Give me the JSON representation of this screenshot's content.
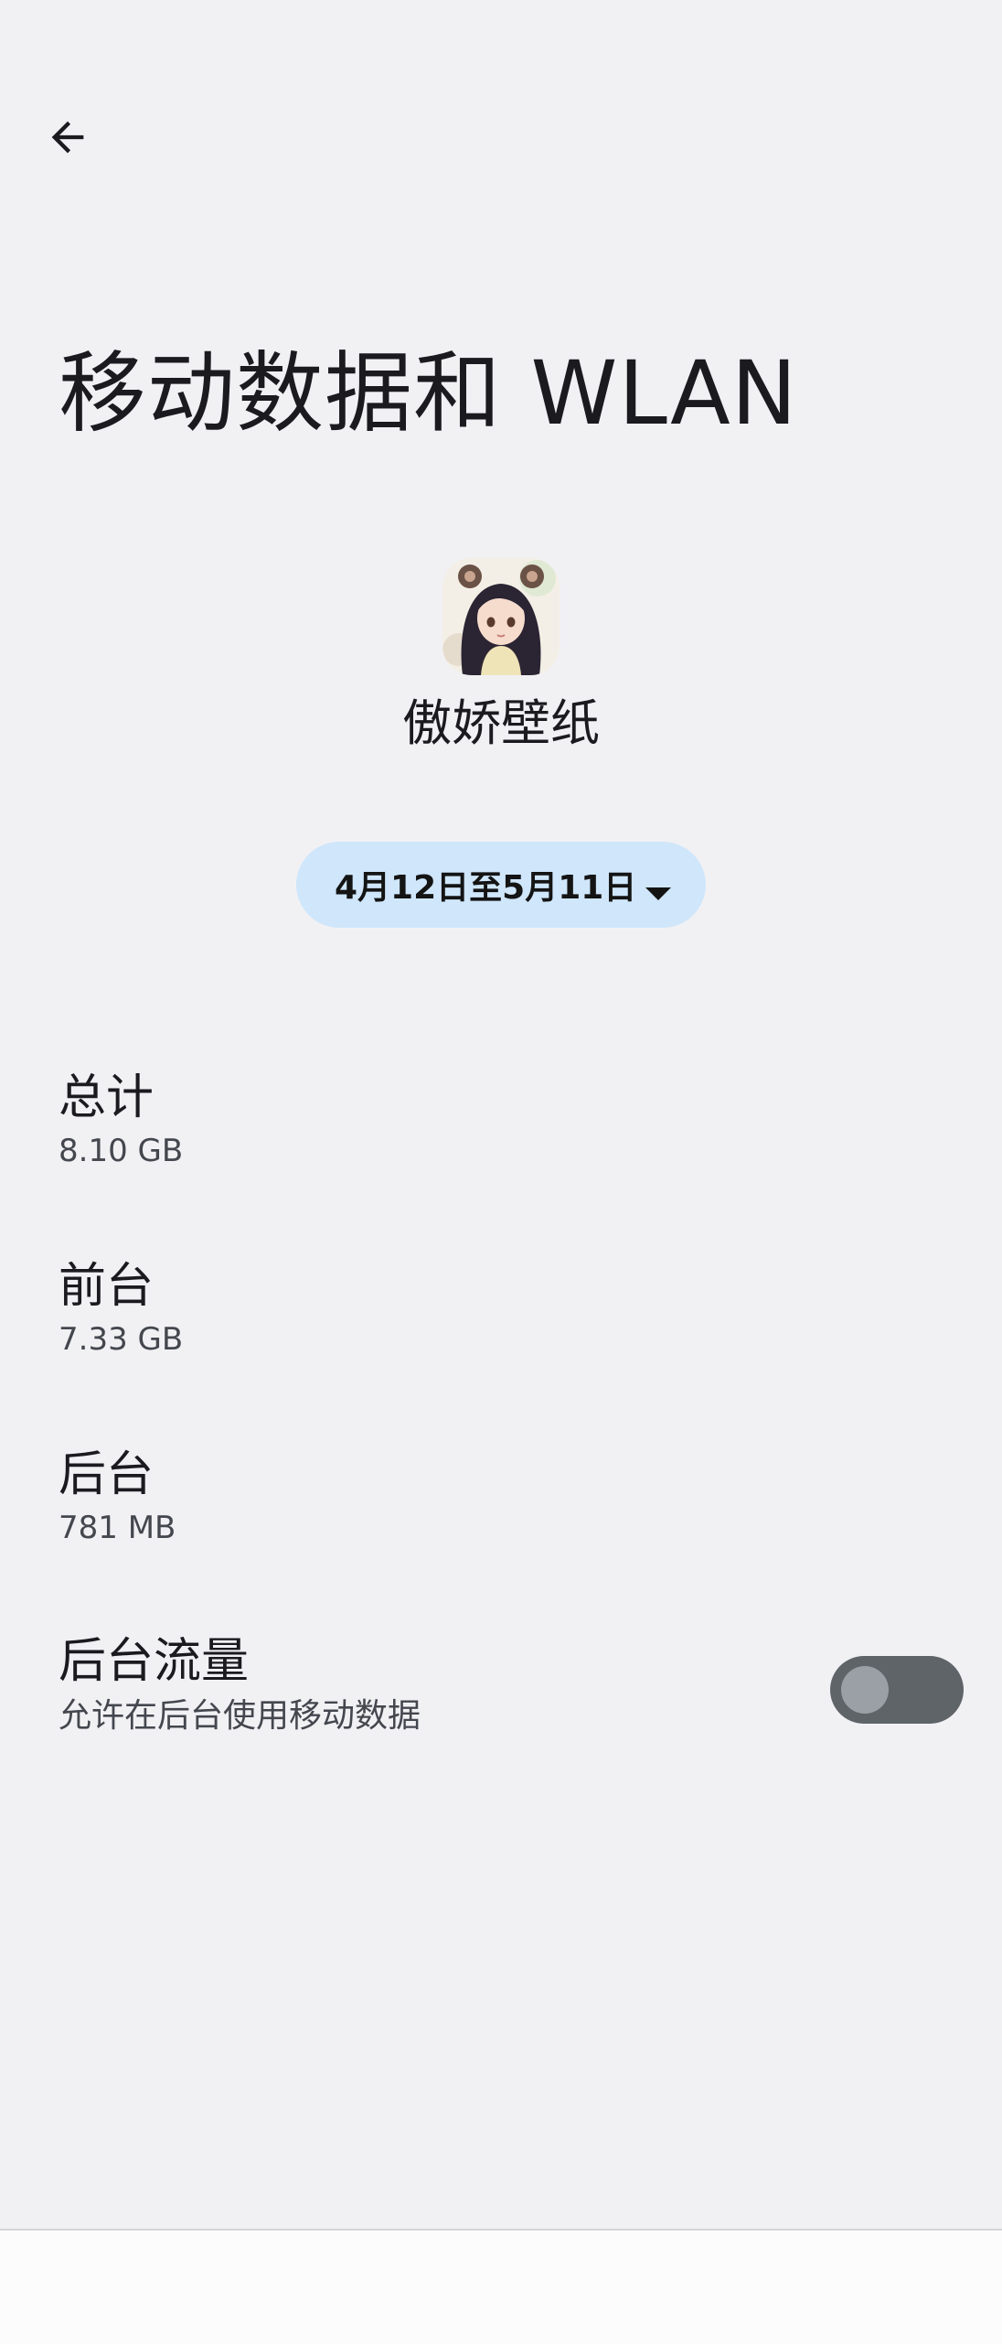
{
  "header": {
    "back_icon": "arrow-back-icon",
    "title": "移动数据和 WLAN"
  },
  "app": {
    "icon": "app-icon-anime-girl",
    "name": "傲娇壁纸"
  },
  "date_range": {
    "label": "4月12日至5月11日",
    "icon": "dropdown-caret-icon"
  },
  "usage": {
    "total": {
      "label": "总计",
      "value": "8.10 GB"
    },
    "foreground": {
      "label": "前台",
      "value": "7.33 GB"
    },
    "background": {
      "label": "后台",
      "value": "781 MB"
    }
  },
  "background_data": {
    "title": "后台流量",
    "subtitle": "允许在后台使用移动数据",
    "enabled": false
  },
  "colors": {
    "page_background": "#f1f1f4",
    "chip_background": "#cfe6fb",
    "toggle_track_off": "#5f6468",
    "toggle_thumb_off": "#9aa0a6"
  }
}
